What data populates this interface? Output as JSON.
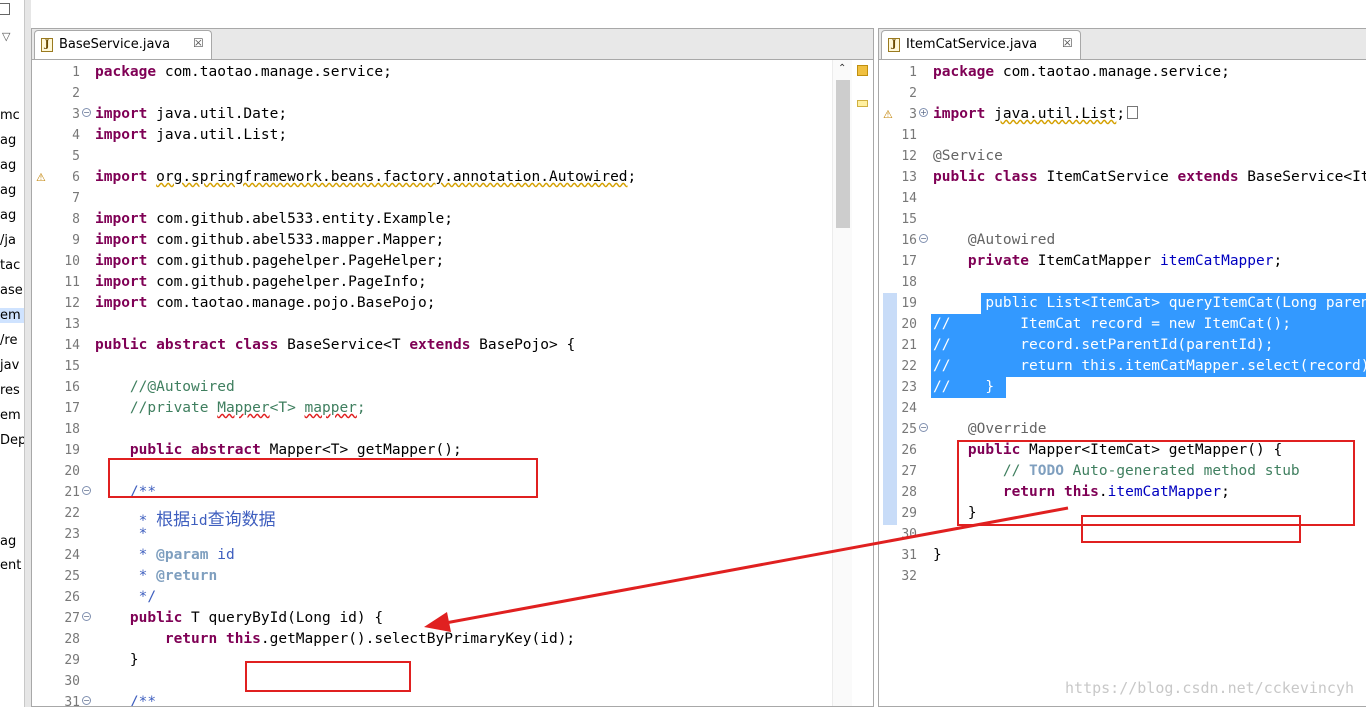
{
  "explorer": {
    "fragments": [
      "mc",
      "ag",
      "ag",
      "ag",
      "ag",
      "/ja",
      "tac",
      "ase",
      "em",
      "/re",
      "jav",
      "res",
      "em",
      "Dep",
      "ag",
      "ent"
    ]
  },
  "left_editor": {
    "tab_title": "BaseService.java",
    "tab_close": "☒",
    "lines": [
      {
        "n": "1",
        "t": "package com.taotao.manage.service;"
      },
      {
        "n": "2",
        "t": ""
      },
      {
        "n": "3",
        "t": "import java.util.Date;"
      },
      {
        "n": "4",
        "t": "import java.util.List;"
      },
      {
        "n": "5",
        "t": ""
      },
      {
        "n": "6",
        "t": "import org.springframework.beans.factory.annotation.Autowired;"
      },
      {
        "n": "7",
        "t": ""
      },
      {
        "n": "8",
        "t": "import com.github.abel533.entity.Example;"
      },
      {
        "n": "9",
        "t": "import com.github.abel533.mapper.Mapper;"
      },
      {
        "n": "10",
        "t": "import com.github.pagehelper.PageHelper;"
      },
      {
        "n": "11",
        "t": "import com.github.pagehelper.PageInfo;"
      },
      {
        "n": "12",
        "t": "import com.taotao.manage.pojo.BasePojo;"
      },
      {
        "n": "13",
        "t": ""
      },
      {
        "n": "14",
        "t": "public abstract class BaseService<T extends BasePojo> {"
      },
      {
        "n": "15",
        "t": ""
      },
      {
        "n": "16",
        "t": "    //@Autowired"
      },
      {
        "n": "17",
        "t": "    //private Mapper<T> mapper;"
      },
      {
        "n": "18",
        "t": ""
      },
      {
        "n": "19",
        "t": "    public abstract Mapper<T> getMapper();"
      },
      {
        "n": "20",
        "t": ""
      },
      {
        "n": "21",
        "t": "    /**"
      },
      {
        "n": "22",
        "t": "     * 根据id查询数据"
      },
      {
        "n": "23",
        "t": "     *"
      },
      {
        "n": "24",
        "t": "     * @param id"
      },
      {
        "n": "25",
        "t": "     * @return"
      },
      {
        "n": "26",
        "t": "     */"
      },
      {
        "n": "27",
        "t": "    public T queryById(Long id) {"
      },
      {
        "n": "28",
        "t": "        return this.getMapper().selectByPrimaryKey(id);"
      },
      {
        "n": "29",
        "t": "    }"
      },
      {
        "n": "30",
        "t": ""
      },
      {
        "n": "31",
        "t": "    /**"
      }
    ]
  },
  "right_editor": {
    "tab_title": "ItemCatService.java",
    "tab_close": "☒",
    "lines": [
      {
        "n": "1",
        "t": "package com.taotao.manage.service;"
      },
      {
        "n": "2",
        "t": ""
      },
      {
        "n": "3",
        "t": "import java.util.List;"
      },
      {
        "n": "11",
        "t": ""
      },
      {
        "n": "12",
        "t": "@Service"
      },
      {
        "n": "13",
        "t": "public class ItemCatService extends BaseService<ItemCat> {"
      },
      {
        "n": "14",
        "t": ""
      },
      {
        "n": "15",
        "t": ""
      },
      {
        "n": "16",
        "t": "    @Autowired"
      },
      {
        "n": "17",
        "t": "    private ItemCatMapper itemCatMapper;"
      },
      {
        "n": "18",
        "t": ""
      },
      {
        "n": "19",
        "t": "//    public List<ItemCat> queryItemCat(Long parentId) {"
      },
      {
        "n": "20",
        "t": "//        ItemCat record = new ItemCat();"
      },
      {
        "n": "21",
        "t": "//        record.setParentId(parentId);"
      },
      {
        "n": "22",
        "t": "//        return this.itemCatMapper.select(record);"
      },
      {
        "n": "23",
        "t": "//    }"
      },
      {
        "n": "24",
        "t": ""
      },
      {
        "n": "25",
        "t": "    @Override"
      },
      {
        "n": "26",
        "t": "    public Mapper<ItemCat> getMapper() {"
      },
      {
        "n": "27",
        "t": "        // TODO Auto-generated method stub"
      },
      {
        "n": "28",
        "t": "        return this.itemCatMapper;"
      },
      {
        "n": "29",
        "t": "    }"
      },
      {
        "n": "30",
        "t": ""
      },
      {
        "n": "31",
        "t": "}"
      },
      {
        "n": "32",
        "t": ""
      }
    ]
  },
  "watermark": "https://blog.csdn.net/cckevincyh",
  "colors": {
    "keyword": "#7f0055",
    "comment": "#3f7f5f",
    "javadoc": "#3f5fbf",
    "annotation": "#646464",
    "field": "#0000c0",
    "selection": "#3399ff",
    "annotation_box": "#e02020"
  }
}
